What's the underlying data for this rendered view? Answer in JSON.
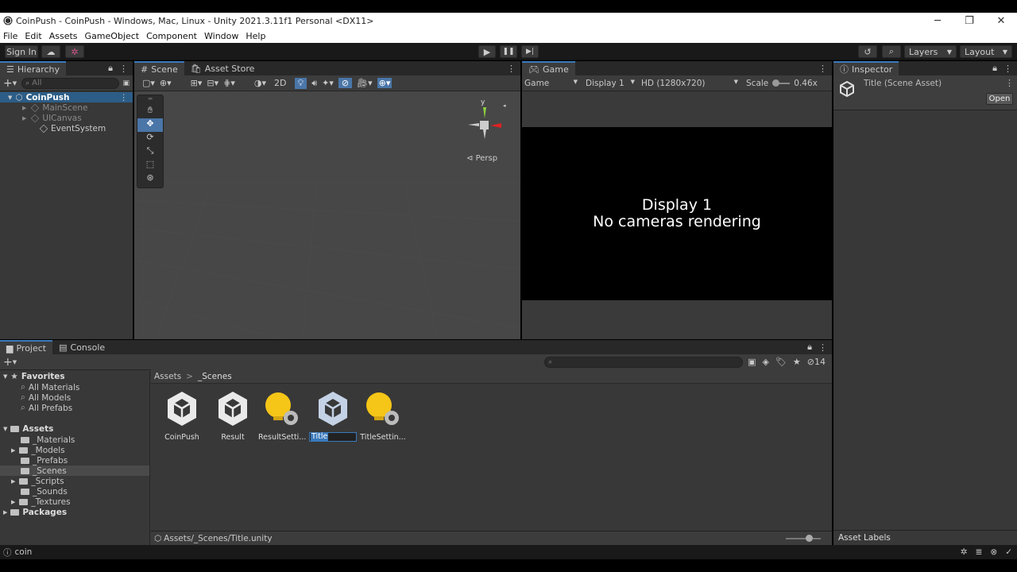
{
  "window": {
    "title": "CoinPush - CoinPush - Windows, Mac, Linux - Unity 2021.3.11f1 Personal <DX11>",
    "minimize": "─",
    "restore": "❐",
    "close": "✕"
  },
  "menu": [
    "File",
    "Edit",
    "Assets",
    "GameObject",
    "Component",
    "Window",
    "Help"
  ],
  "toolbar": {
    "sign_in": "Sign In",
    "layers": "Layers",
    "layout": "Layout"
  },
  "hierarchy": {
    "tab": "Hierarchy",
    "search_placeholder": "All",
    "scene": "CoinPush",
    "items": [
      {
        "label": "MainScene",
        "dim": true
      },
      {
        "label": "UICanvas",
        "dim": true
      },
      {
        "label": "EventSystem",
        "dim": false
      }
    ]
  },
  "scene_view": {
    "tab_scene": "Scene",
    "tab_store": "Asset Store",
    "mode_2d": "2D",
    "persp": "Persp",
    "axis_y": "y"
  },
  "game_view": {
    "tab": "Game",
    "mode": "Game",
    "display": "Display 1",
    "resolution": "HD (1280x720)",
    "scale_label": "Scale",
    "scale_value": "0.46x",
    "message_line1": "Display 1",
    "message_line2": "No cameras rendering"
  },
  "inspector": {
    "tab": "Inspector",
    "asset_title": "Title (Scene Asset)",
    "open_button": "Open",
    "asset_labels": "Asset Labels"
  },
  "project": {
    "tab_project": "Project",
    "tab_console": "Console",
    "hidden_count": "14",
    "favorites_label": "Favorites",
    "favorites": [
      "All Materials",
      "All Models",
      "All Prefabs"
    ],
    "assets_label": "Assets",
    "folders": [
      "_Materials",
      "_Models",
      "_Prefabs",
      "_Scenes",
      "_Scripts",
      "_Sounds",
      "_Textures"
    ],
    "packages_label": "Packages",
    "breadcrumb_root": "Assets",
    "breadcrumb_sep": ">",
    "breadcrumb_current": "_Scenes",
    "assets": [
      {
        "label": "CoinPush",
        "kind": "scene"
      },
      {
        "label": "Result",
        "kind": "scene"
      },
      {
        "label": "ResultSetti...",
        "kind": "settings"
      },
      {
        "label": "Title",
        "kind": "scene"
      },
      {
        "label": "TitleSettin...",
        "kind": "settings"
      }
    ],
    "footer_path": "Assets/_Scenes/Title.unity"
  },
  "statusbar": {
    "text": "coin"
  },
  "colors": {
    "accent": "#3a79bb",
    "selection": "#2c5d87",
    "panel": "#383838",
    "scene_bg": "#474747",
    "settings_yellow": "#f5c518"
  }
}
